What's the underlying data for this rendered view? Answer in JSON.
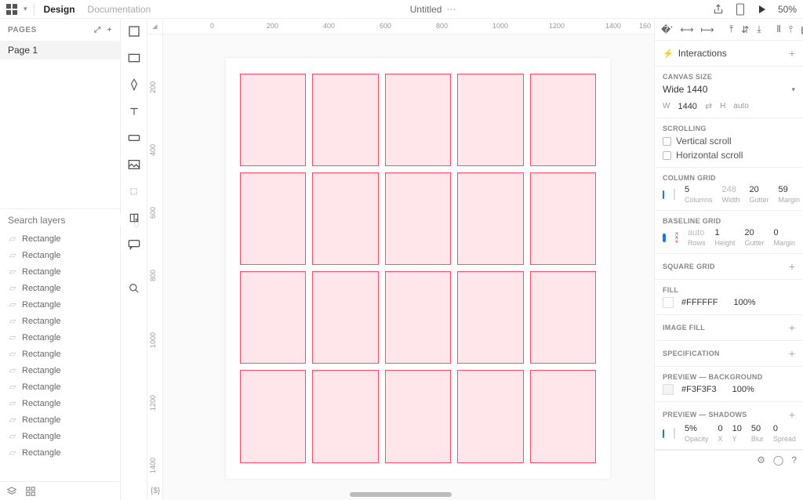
{
  "topbar": {
    "design_tab": "Design",
    "docs_tab": "Documentation",
    "title": "Untitled",
    "zoom": "50%"
  },
  "left": {
    "pages_label": "PAGES",
    "page1": "Page 1",
    "search_placeholder": "Search layers",
    "layers": [
      "Rectangle",
      "Rectangle",
      "Rectangle",
      "Rectangle",
      "Rectangle",
      "Rectangle",
      "Rectangle",
      "Rectangle",
      "Rectangle",
      "Rectangle",
      "Rectangle",
      "Rectangle",
      "Rectangle",
      "Rectangle"
    ]
  },
  "ruler_h": [
    "0",
    "200",
    "400",
    "600",
    "800",
    "1000",
    "1200",
    "1400"
  ],
  "ruler_h_end": "160",
  "ruler_v": [
    "200",
    "400",
    "600",
    "800",
    "1000",
    "1200",
    "1400"
  ],
  "canvas_bl": "{$}",
  "right": {
    "interactions": "Interactions",
    "canvas_size_label": "CANVAS SIZE",
    "canvas_preset": "Wide 1440",
    "w_label": "W",
    "w_value": "1440",
    "h_label": "H",
    "h_placeholder": "auto",
    "scrolling_label": "SCROLLING",
    "vscroll": "Vertical scroll",
    "hscroll": "Horizontal scroll",
    "colgrid_label": "COLUMN GRID",
    "col_columns_v": "5",
    "col_columns_n": "Columns",
    "col_width_v": "248",
    "col_width_n": "Width",
    "col_gutter_v": "20",
    "col_gutter_n": "Gutter",
    "col_margin_v": "59",
    "col_margin_n": "Margin",
    "baseline_label": "BASELINE GRID",
    "bl_rows_v": "auto",
    "bl_rows_n": "Rows",
    "bl_height_v": "1",
    "bl_height_n": "Height",
    "bl_gutter_v": "20",
    "bl_gutter_n": "Gutter",
    "bl_margin_v": "0",
    "bl_margin_n": "Margin",
    "square_label": "SQUARE GRID",
    "fill_label": "FILL",
    "fill_hex": "#FFFFFF",
    "fill_opacity": "100%",
    "imgfill_label": "IMAGE FILL",
    "spec_label": "SPECIFICATION",
    "previewbg_label": "PREVIEW — BACKGROUND",
    "pbg_hex": "#F3F3F3",
    "pbg_opacity": "100%",
    "shadows_label": "PREVIEW — SHADOWS",
    "sh_op_v": "5%",
    "sh_op_n": "Opacity",
    "sh_x_v": "0",
    "sh_x_n": "X",
    "sh_y_v": "10",
    "sh_y_n": "Y",
    "sh_blur_v": "50",
    "sh_blur_n": "Blur",
    "sh_spread_v": "0",
    "sh_spread_n": "Spread"
  }
}
